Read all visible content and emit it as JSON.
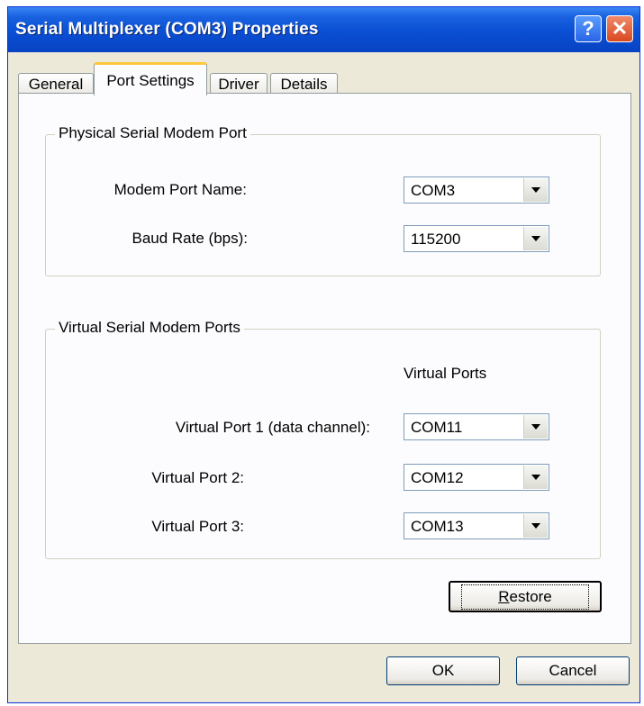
{
  "window": {
    "title": "Serial Multiplexer (COM3) Properties",
    "help_label": "?",
    "close_label": "✕"
  },
  "tabs": [
    {
      "label": "General",
      "active": false
    },
    {
      "label": "Port Settings",
      "active": true
    },
    {
      "label": "Driver",
      "active": false
    },
    {
      "label": "Details",
      "active": false
    }
  ],
  "physical": {
    "legend": "Physical Serial Modem Port",
    "port_name_label": "Modem Port Name:",
    "port_name_value": "COM3",
    "baud_label": "Baud Rate (bps):",
    "baud_value": "115200"
  },
  "virtual": {
    "legend": "Virtual Serial Modem Ports",
    "column_header": "Virtual Ports",
    "ports": [
      {
        "label": "Virtual Port 1 (data channel):",
        "value": "COM11"
      },
      {
        "label": "Virtual Port 2:",
        "value": "COM12"
      },
      {
        "label": "Virtual Port 3:",
        "value": "COM13"
      }
    ]
  },
  "buttons": {
    "restore_first": "R",
    "restore_rest": "estore",
    "ok": "OK",
    "cancel": "Cancel"
  },
  "colors": {
    "title_bar": "#0a4fd4",
    "active_tab_accent": "#ffc83c",
    "dialog_face": "#ece9d8"
  }
}
